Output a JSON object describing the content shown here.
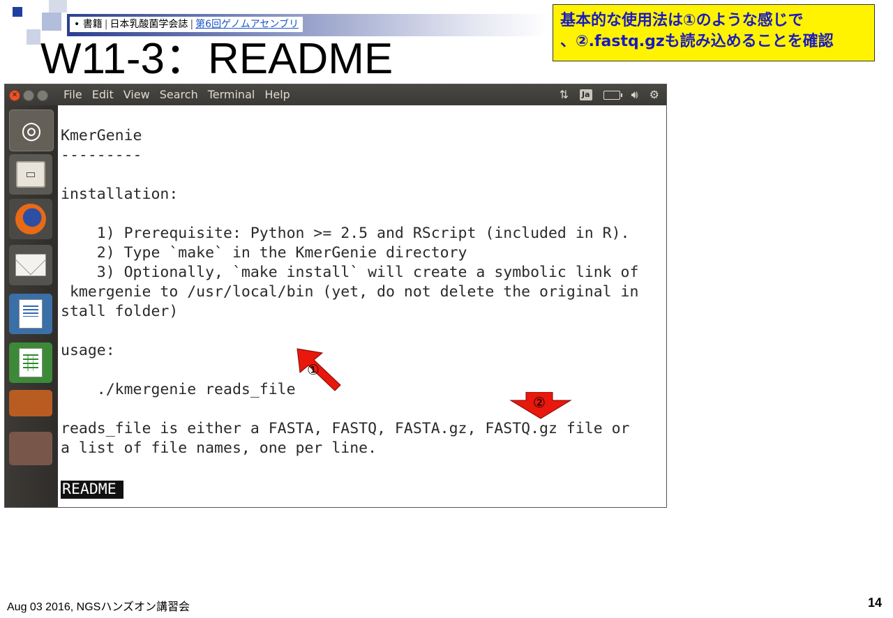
{
  "header": {
    "breadcrumb": {
      "bullet": "•",
      "item1": "書籍",
      "item2": "日本乳酸菌学会誌",
      "item3": "第6回ゲノムアセンブリ",
      "separator": "|"
    },
    "title": "W11-3：README"
  },
  "callout": {
    "line1": "基本的な使用法は①のような感じで",
    "line2": "、②.fastq.gzも読み込めることを確認"
  },
  "terminal": {
    "menus": [
      "File",
      "Edit",
      "View",
      "Search",
      "Terminal",
      "Help"
    ],
    "tray": {
      "network_icon": "network-updown-icon",
      "ja_label": "Ja",
      "battery_icon": "battery-icon",
      "volume_icon": "volume-icon",
      "settings_icon": "gear-icon"
    },
    "lines": [
      "KmerGenie",
      "---------",
      "",
      "installation:",
      "",
      "    1) Prerequisite: Python >= 2.5 and RScript (included in R).",
      "    2) Type `make` in the KmerGenie directory",
      "    3) Optionally, `make install` will create a symbolic link of",
      " kmergenie to /usr/local/bin (yet, do not delete the original in",
      "stall folder)",
      "",
      "usage:",
      "",
      "    ./kmergenie reads_file",
      "",
      "reads_file is either a FASTA, FASTQ, FASTA.gz, FASTQ.gz file or",
      "a list of file names, one per line."
    ],
    "status_label": "README"
  },
  "launcher": [
    "ubuntu-icon",
    "files-icon",
    "firefox-icon",
    "mail-icon",
    "writer-icon",
    "calc-icon",
    "impress-icon",
    "apps-stack-icon"
  ],
  "annotations": {
    "marker1": "①",
    "marker2": "②"
  },
  "footer": {
    "left": "Aug 03 2016, NGSハンズオン講習会",
    "page": "14"
  },
  "colors": {
    "callout_bg": "#fff300",
    "callout_text": "#1b1bbd",
    "arrow": "#e8180c",
    "terminal_bar": "#3a3935"
  }
}
